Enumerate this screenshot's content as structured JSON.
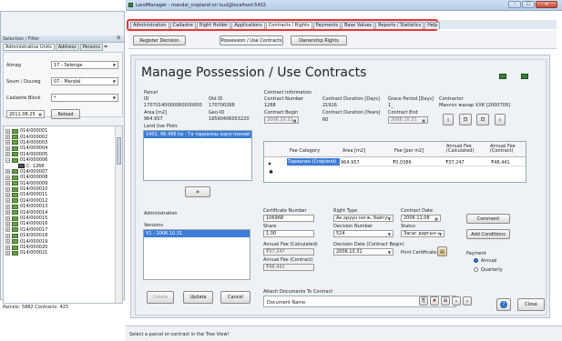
{
  "window": {
    "title": "LandManager - mandal_cropland on tuul@localhost:5432"
  },
  "left_panel": {
    "title": "Selection / Filter",
    "tabs": [
      "Administrative Units",
      "Address",
      "Persons"
    ],
    "aimag_label": "Aimag",
    "aimag_value": "17 - Selenge",
    "soum_label": "Soum / Duureg",
    "soum_value": "07 - Mandal",
    "cadastre_label": "Cadastre Block",
    "cadastre_value": "*",
    "date_value": "2011.08.25",
    "reload_label": "Reload",
    "tree_items": [
      "014/000001",
      "014/000002",
      "014/000003",
      "014/000004",
      "014/000005",
      "014/000006",
      "C: 1268",
      "014/000007",
      "014/000008",
      "014/000009",
      "014/000010",
      "014/000011",
      "014/000012",
      "014/000013",
      "014/000014",
      "014/000015",
      "014/000016",
      "014/000017",
      "014/000018",
      "014/000019",
      "014/000020",
      "014/000021"
    ],
    "footer": "Parcels: 5882 Contracts: 425"
  },
  "menu_tabs": [
    "Administration",
    "Cadastre",
    "Right Holder",
    "Applications",
    "Contracts / Rights",
    "Payments",
    "Base Values",
    "Reports / Statistics",
    "Help"
  ],
  "subtabs": [
    "Register Decision",
    "Possession / Use Contracts",
    "Ownership Rights"
  ],
  "main": {
    "title": "Manage Possession / Use Contracts",
    "parcel": {
      "section": "Parcel",
      "id_label": "ID",
      "id_value": "17070140000060000000",
      "old_id_label": "Old ID",
      "old_id_value": "170700268",
      "area_label": "Area [m2]",
      "area_value": "964.957",
      "geo_id_label": "Geo-ID",
      "geo_id_value": "18590406053220",
      "plots_label": "Land Use Plots",
      "plot_item": "1401: 96.496 ha - Та тариалны хэрэглээний газар"
    },
    "contract": {
      "section": "Contract Information",
      "number_label": "Contract Number",
      "number_value": "1268",
      "duration_days_label": "Contract Duration [Days]",
      "duration_days_value": "21916",
      "grace_label": "Grace Period [Days]",
      "grace_value": "1_",
      "contractor_label": "Contractor",
      "contractor_value": "Мангол жанар ХХК [2000709]",
      "begin_label": "Contract Begin",
      "begin_value": "2006.10.31",
      "duration_years_label": "Contract Duration [Years]",
      "duration_years_value": "60",
      "end_label": "Contract End",
      "end_value": "2066.10.31"
    },
    "fee_table": {
      "headers": [
        "Fee Category",
        "Area [m2]",
        "Fee [per m2]",
        "Annual Fee (Calculated)",
        "Annual Fee (Contract)"
      ],
      "rows": [
        [
          "Тариалан (Cropland)",
          "964.957",
          "₮0.0386",
          "₮37.247",
          "₮48.441"
        ]
      ]
    },
    "move_label": "»",
    "administration": {
      "section": "Administration",
      "versions_label": "Versions",
      "version_item": "V1 - 2006.10.31"
    },
    "certificate": {
      "cert_label": "Certificate Number",
      "cert_value": "106968",
      "share_label": "Share",
      "share_value": "1.00",
      "fee_calc_label": "Annual Fee (Calculated)",
      "fee_calc_value": "₮37,247",
      "fee_contract_label": "Annual Fee (Contract)",
      "fee_contract_value": "₮48,441",
      "right_type_label": "Right Type",
      "right_type_value": "Ак.эрүүн нэгж, байгууллага",
      "decision_number_label": "Decision Number",
      "decision_number_value": "524",
      "decision_date_label": "Decision Date (Contract Begin)",
      "decision_date_value": "2006.10.31",
      "contract_date_label": "Contract Date",
      "contract_date_value": "2006.11.08",
      "status_label": "Status",
      "status_value": "Засаг даргын захир",
      "print_label": "Print Certificate:",
      "comment_label": "Comment",
      "add_conditions_label": "Add Conditions",
      "payment_label": "Payment",
      "annual_label": "Annual",
      "quarterly_label": "Quarterly"
    },
    "attach": {
      "label": "Attach Documents To Contract",
      "doc_name_label": "Document Name"
    },
    "buttons": {
      "create": "Create",
      "update": "Update",
      "cancel": "Cancel",
      "close": "Close"
    }
  },
  "status_bar": "Select a parcel or contract in the Tree View!"
}
